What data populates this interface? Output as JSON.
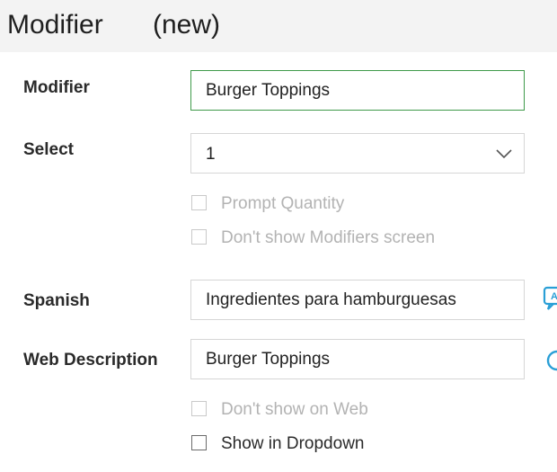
{
  "header": {
    "title": "Modifier",
    "status": "(new)"
  },
  "form": {
    "modifier": {
      "label": "Modifier",
      "value": "Burger Toppings"
    },
    "select": {
      "label": "Select",
      "value": "1"
    },
    "prompt_quantity": {
      "label": "Prompt Quantity",
      "checked": false,
      "disabled": true
    },
    "dont_show_modifiers": {
      "label": "Don't show Modifiers screen",
      "checked": false,
      "disabled": true
    },
    "spanish": {
      "label": "Spanish",
      "value": "Ingredientes para hamburguesas"
    },
    "web_description": {
      "label": "Web Description",
      "value": "Burger Toppings"
    },
    "dont_show_on_web": {
      "label": "Don't show on Web",
      "checked": false,
      "disabled": true
    },
    "show_in_dropdown": {
      "label": "Show in Dropdown",
      "checked": false,
      "disabled": false
    }
  },
  "icons": {
    "spanish_side": "translate-icon",
    "web_side": "refresh-icon"
  },
  "colors": {
    "focus_border": "#3f9a4a",
    "side_icon": "#2a9fd6",
    "header_bg": "#f3f3f3"
  }
}
